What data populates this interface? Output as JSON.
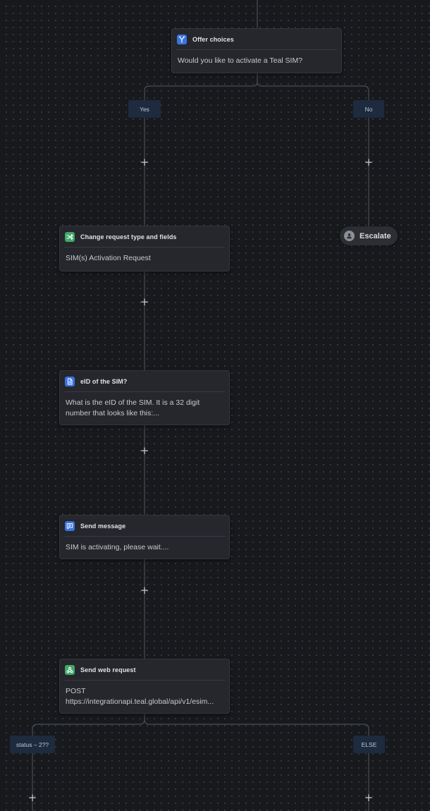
{
  "nodes": {
    "offer_choices": {
      "title": "Offer choices",
      "icon": "branch-icon",
      "body": "Would you like to activate a Teal SIM?"
    },
    "change_request": {
      "title": "Change request type and fields",
      "icon": "shuffle-icon",
      "body": "SIM(s) Activation Request"
    },
    "eid_question": {
      "title": "eID of the SIM?",
      "icon": "document-icon",
      "body_line1": "What is the eID of the SIM. It is a 32 digit",
      "body_line2": "number that looks like this:..."
    },
    "send_message": {
      "title": "Send message",
      "icon": "message-icon",
      "body": "SIM is activating, please wait...."
    },
    "web_request": {
      "title": "Send web request",
      "icon": "webhook-icon",
      "body_line1": "POST",
      "body_line2": "https://integrationapi.teal.global/api/v1/esim..."
    }
  },
  "branches": {
    "yes": "Yes",
    "no": "No",
    "status": "status – 2??",
    "else": "ELSE"
  },
  "escalate": {
    "label": "Escalate",
    "icon": "user-icon"
  },
  "add_step": "+",
  "colors": {
    "canvas_bg": "#17191d",
    "node_bg": "#25272c",
    "connector": "#4a4e55",
    "branch_label_bg": "#1e2a3d",
    "icon_blue": "#3b74e0",
    "icon_green": "#41a86a"
  }
}
